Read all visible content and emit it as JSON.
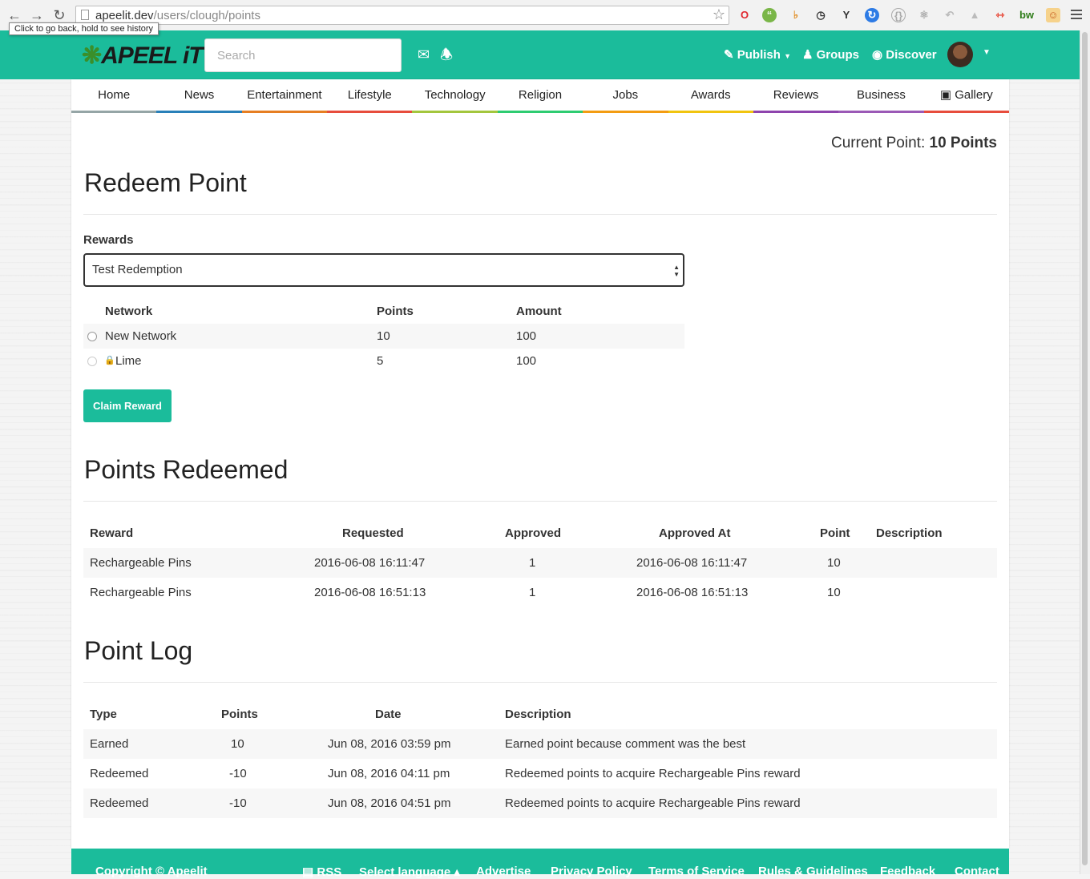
{
  "browser": {
    "url_host": "apeelit.dev",
    "url_path": "/users/clough/points",
    "tooltip": "Click to go back, hold to see history"
  },
  "header": {
    "logo_text": "APEEL iT",
    "search_placeholder": "Search",
    "publish_label": "Publish",
    "groups_label": "Groups",
    "discover_label": "Discover"
  },
  "categories": [
    {
      "label": "Home",
      "color": "#95a5a6"
    },
    {
      "label": "News",
      "color": "#2980b9"
    },
    {
      "label": "Entertainment",
      "color": "#e67e22"
    },
    {
      "label": "Lifestyle",
      "color": "#e74c3c"
    },
    {
      "label": "Technology",
      "color": "#a3c63d"
    },
    {
      "label": "Religion",
      "color": "#2ecc71"
    },
    {
      "label": "Jobs",
      "color": "#f39c12"
    },
    {
      "label": "Awards",
      "color": "#f1c40f"
    },
    {
      "label": "Reviews",
      "color": "#8e44ad"
    },
    {
      "label": "Business",
      "color": "#9b59b6"
    },
    {
      "label": "Gallery",
      "color": "#e74c3c"
    }
  ],
  "current_point": {
    "label": "Current Point:",
    "value": "10 Points"
  },
  "redeem": {
    "title": "Redeem Point",
    "rewards_label": "Rewards",
    "selected_reward": "Test Redemption",
    "headers": {
      "network": "Network",
      "points": "Points",
      "amount": "Amount"
    },
    "rows": [
      {
        "network": "New Network",
        "points": "10",
        "amount": "100"
      },
      {
        "network": "Lime",
        "points": "5",
        "amount": "100"
      }
    ],
    "claim_label": "Claim Reward"
  },
  "redeemed": {
    "title": "Points Redeemed",
    "headers": {
      "reward": "Reward",
      "requested": "Requested",
      "approved": "Approved",
      "approved_at": "Approved At",
      "point": "Point",
      "description": "Description"
    },
    "rows": [
      {
        "reward": "Rechargeable Pins",
        "requested": "2016-06-08 16:11:47",
        "approved": "1",
        "approved_at": "2016-06-08 16:11:47",
        "point": "10",
        "description": ""
      },
      {
        "reward": "Rechargeable Pins",
        "requested": "2016-06-08 16:51:13",
        "approved": "1",
        "approved_at": "2016-06-08 16:51:13",
        "point": "10",
        "description": ""
      }
    ]
  },
  "log": {
    "title": "Point Log",
    "headers": {
      "type": "Type",
      "points": "Points",
      "date": "Date",
      "description": "Description"
    },
    "rows": [
      {
        "type": "Earned",
        "points": "10",
        "date": "Jun 08, 2016 03:59 pm",
        "description": "Earned point because comment was the best"
      },
      {
        "type": "Redeemed",
        "points": "-10",
        "date": "Jun 08, 2016 04:11 pm",
        "description": "Redeemed points to acquire Rechargeable Pins reward"
      },
      {
        "type": "Redeemed",
        "points": "-10",
        "date": "Jun 08, 2016 04:51 pm",
        "description": "Redeemed points to acquire Rechargeable Pins reward"
      }
    ]
  },
  "footer": {
    "copyright": "Copyright © Apeelit",
    "links": [
      "RSS",
      "Select language",
      "Advertise",
      "Privacy Policy",
      "Terms of Service",
      "Rules & Guidelines",
      "Feedback",
      "Contact"
    ]
  },
  "colors": {
    "brand": "#1bbc9b"
  }
}
